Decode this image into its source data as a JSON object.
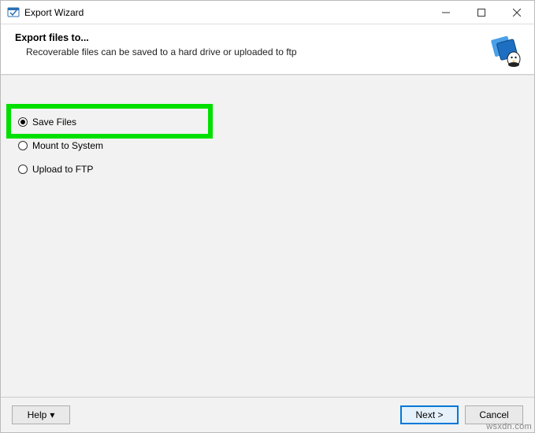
{
  "window": {
    "title": "Export Wizard"
  },
  "header": {
    "title": "Export files to...",
    "subtitle": "Recoverable files can be saved to a hard drive or uploaded to ftp"
  },
  "options": {
    "save_files": {
      "label": "Save Files",
      "selected": true
    },
    "mount": {
      "label": "Mount to System",
      "selected": false
    },
    "upload_ftp": {
      "label": "Upload to FTP",
      "selected": false
    }
  },
  "footer": {
    "help": "Help",
    "next": "Next >",
    "cancel": "Cancel"
  },
  "watermark": "wsxdn.com"
}
